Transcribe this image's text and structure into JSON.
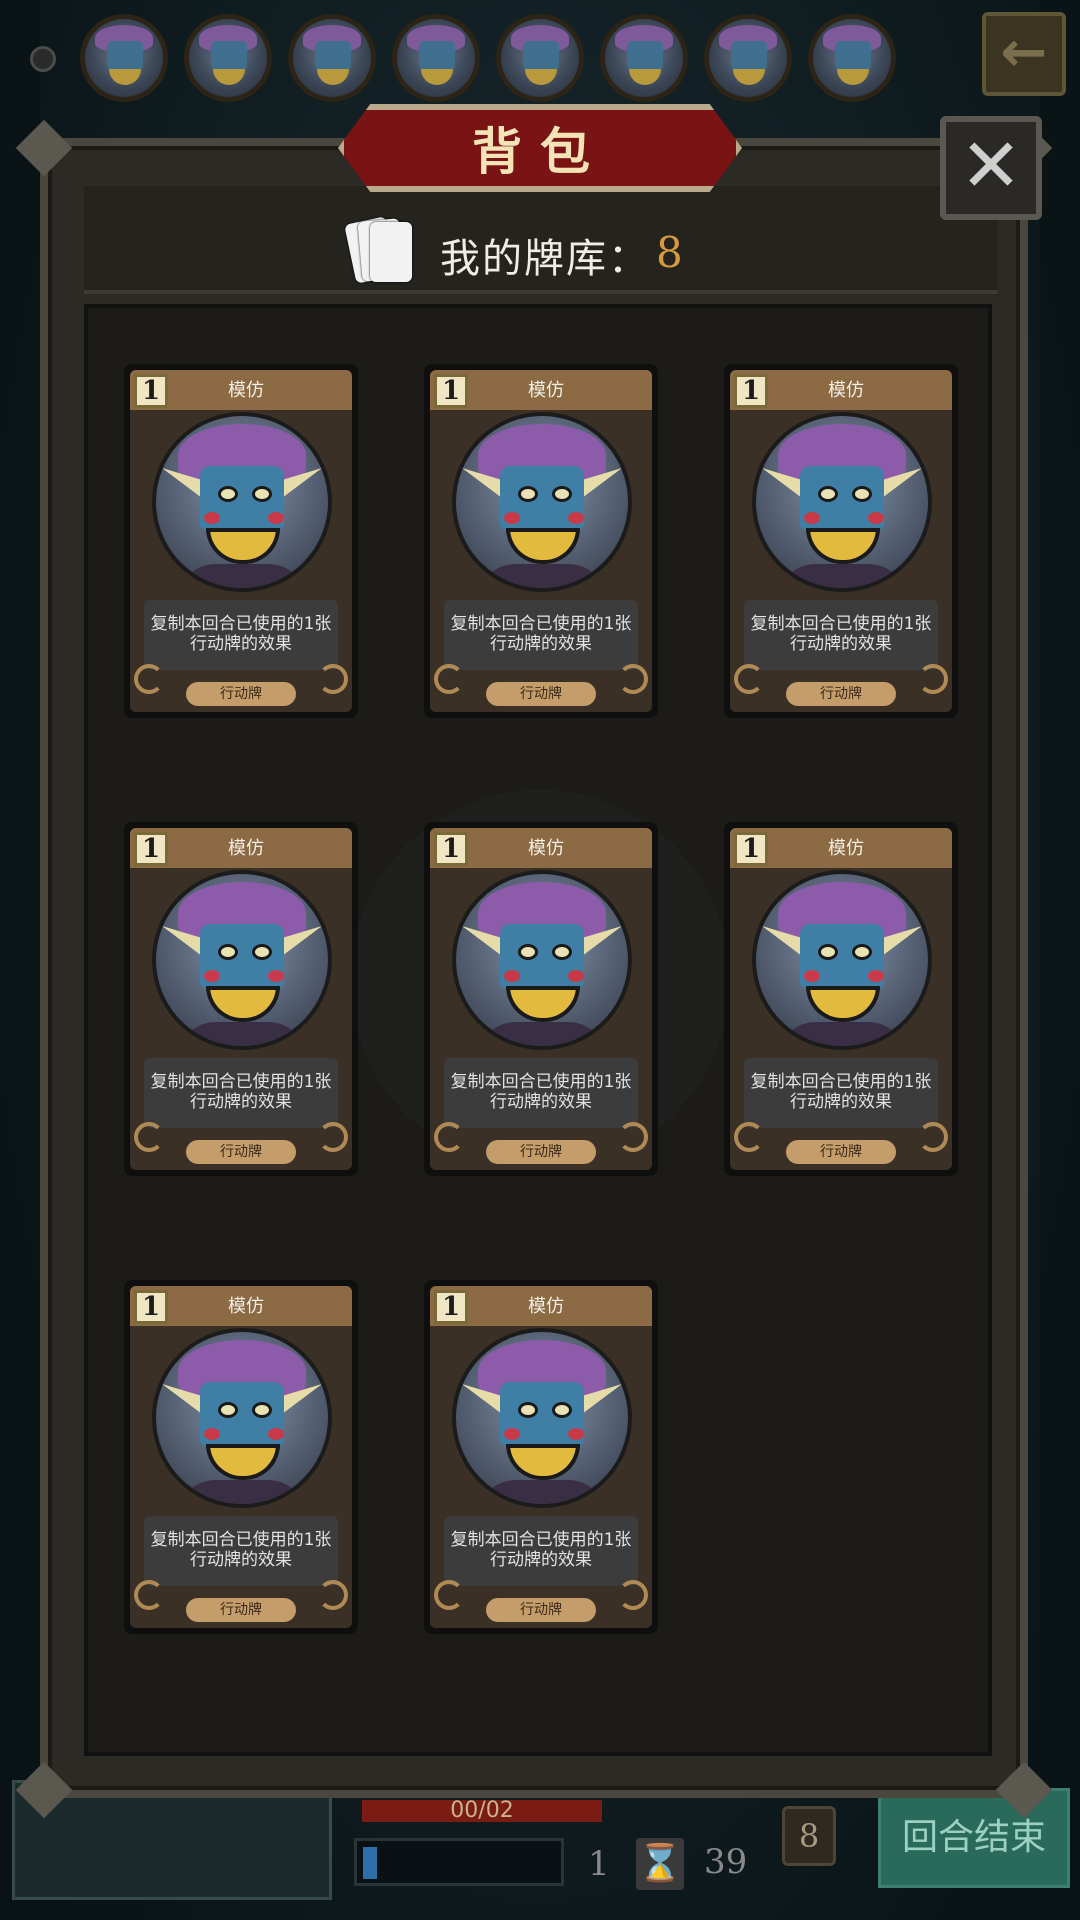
{
  "top_bar": {
    "enemy_portraits": 8,
    "back_icon": "back-arrow-icon"
  },
  "dialog": {
    "title": "背包",
    "close_icon": "close-icon",
    "deck_icon": "cards-icon",
    "deck_label": "我的牌库：",
    "deck_count": "8"
  },
  "cards": [
    {
      "cost": "1",
      "name": "模仿",
      "description": "复制本回合已使用的1张行动牌的效果",
      "type": "行动牌"
    },
    {
      "cost": "1",
      "name": "模仿",
      "description": "复制本回合已使用的1张行动牌的效果",
      "type": "行动牌"
    },
    {
      "cost": "1",
      "name": "模仿",
      "description": "复制本回合已使用的1张行动牌的效果",
      "type": "行动牌"
    },
    {
      "cost": "1",
      "name": "模仿",
      "description": "复制本回合已使用的1张行动牌的效果",
      "type": "行动牌"
    },
    {
      "cost": "1",
      "name": "模仿",
      "description": "复制本回合已使用的1张行动牌的效果",
      "type": "行动牌"
    },
    {
      "cost": "1",
      "name": "模仿",
      "description": "复制本回合已使用的1张行动牌的效果",
      "type": "行动牌"
    },
    {
      "cost": "1",
      "name": "模仿",
      "description": "复制本回合已使用的1张行动牌的效果",
      "type": "行动牌"
    },
    {
      "cost": "1",
      "name": "模仿",
      "description": "复制本回合已使用的1张行动牌的效果",
      "type": "行动牌"
    }
  ],
  "hud": {
    "hp_text": "00/02",
    "energy_fraction": 0.07,
    "energy_value": "1",
    "hourglass_icon": "hourglass-icon",
    "time_value": "39",
    "deck_badge": "8",
    "end_turn_label": "回合结束"
  },
  "colors": {
    "title_banner": "#7a1414",
    "deck_count": "#d69a3e",
    "end_turn": "#2a6a5a"
  }
}
